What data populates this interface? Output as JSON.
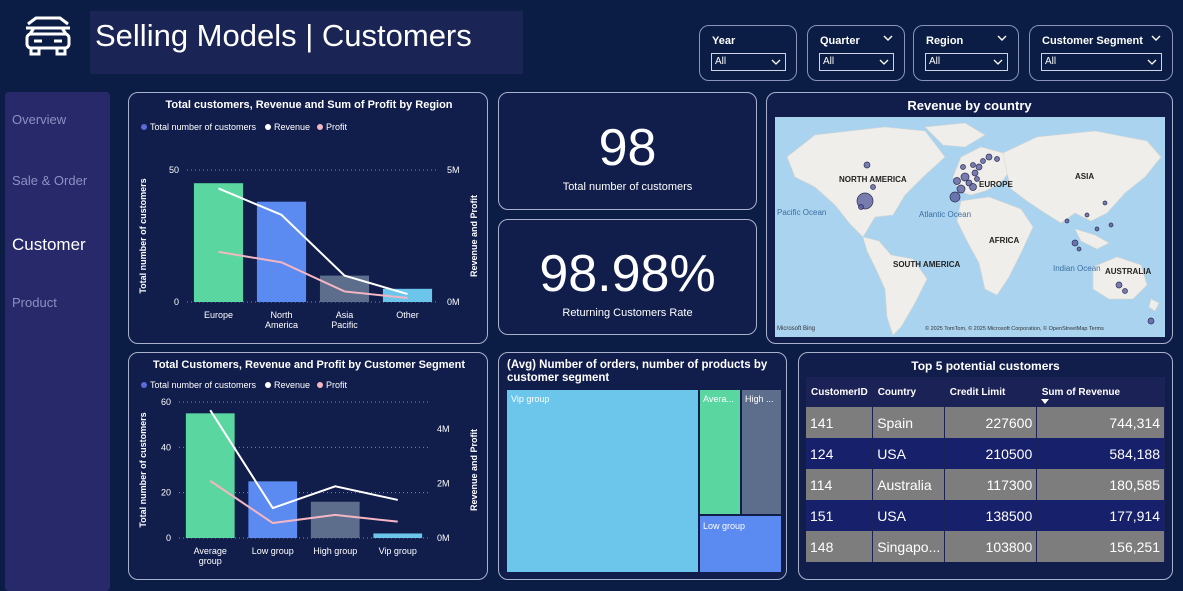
{
  "header": {
    "title": "Selling Models | Customers",
    "logo_icon": "car-icon"
  },
  "slicers": [
    {
      "label": "Year",
      "value": "All"
    },
    {
      "label": "Quarter",
      "value": "All"
    },
    {
      "label": "Region",
      "value": "All"
    },
    {
      "label": "Customer Segment",
      "value": "All"
    }
  ],
  "nav": {
    "items": [
      {
        "label": "Overview"
      },
      {
        "label": "Sale & Order"
      },
      {
        "label": "Customer"
      },
      {
        "label": "Product"
      }
    ],
    "active": "Customer"
  },
  "kpis": {
    "customers": {
      "value": "98",
      "label": "Total number of customers"
    },
    "returning": {
      "value": "98.98%",
      "label": "Returning Customers Rate"
    }
  },
  "map": {
    "title": "Revenue by country",
    "labels": {
      "north_america": "NORTH AMERICA",
      "europe": "EUROPE",
      "asia": "ASIA",
      "africa": "AFRICA",
      "south_america": "SOUTH AMERICA",
      "australia": "AUSTRALIA",
      "pacific": "Pacific Ocean",
      "atlantic": "Atlantic Ocean",
      "indian": "Indian Ocean"
    },
    "bing": "Microsoft Bing",
    "credit": "© 2025 TomTom, © 2025 Microsoft Corporation, © OpenStreetMap  Terms"
  },
  "treemap": {
    "title": "(Avg) Number of orders, number of products by customer segment",
    "tiles": [
      {
        "label": "Vip group",
        "color": "#6cc6ec"
      },
      {
        "label": "Avera...",
        "color": "#5ad6a0"
      },
      {
        "label": "High ...",
        "color": "#5c6e8c"
      },
      {
        "label": "Low group",
        "color": "#5b8af0"
      }
    ]
  },
  "top5": {
    "title": "Top 5 potential customers",
    "columns": [
      "CustomerID",
      "Country",
      "Credit Limit",
      "Sum of Revenue"
    ],
    "rows": [
      {
        "id": "141",
        "country": "Spain",
        "credit": "227600",
        "revenue": "744,314"
      },
      {
        "id": "124",
        "country": "USA",
        "credit": "210500",
        "revenue": "584,188"
      },
      {
        "id": "114",
        "country": "Australia",
        "credit": "117300",
        "revenue": "180,585"
      },
      {
        "id": "151",
        "country": "USA",
        "credit": "138500",
        "revenue": "177,914"
      },
      {
        "id": "148",
        "country": "Singapo...",
        "credit": "103800",
        "revenue": "156,251"
      }
    ]
  },
  "colors": {
    "customers": "#5ad6a0",
    "revenue": "#ffffff",
    "profit": "#f4b6c2",
    "bar_colors": [
      "#5ad6a0",
      "#5b8af0",
      "#5c6e8c",
      "#6cc6ec"
    ]
  },
  "chart_data": [
    {
      "type": "bar",
      "title": "Total customers, Revenue and Sum of Profit by Region",
      "categories": [
        "Europe",
        "North America",
        "Asia Pacific",
        "Other"
      ],
      "series": [
        {
          "name": "Total number of customers",
          "values": [
            45,
            38,
            10,
            5
          ]
        },
        {
          "name": "Revenue",
          "values": [
            4.3,
            3.3,
            1.0,
            0.3
          ]
        },
        {
          "name": "Profit",
          "values": [
            1.9,
            1.5,
            0.4,
            0.15
          ]
        }
      ],
      "ylabel": "Total number of customers",
      "y2label": "Revenue and Profit",
      "ylim": [
        0,
        50
      ],
      "y2lim": [
        0,
        5
      ],
      "yticks": [
        "0",
        "50"
      ],
      "y2ticks": [
        "0M",
        "5M"
      ],
      "legend": "top-left"
    },
    {
      "type": "bar",
      "title": "Total Customers, Revenue and Profit by Customer Segment",
      "categories": [
        "Average group",
        "Low group",
        "High group",
        "Vip group"
      ],
      "series": [
        {
          "name": "Total number of customers",
          "values": [
            55,
            25,
            16,
            2
          ]
        },
        {
          "name": "Revenue",
          "values": [
            4.7,
            1.1,
            1.9,
            1.4
          ]
        },
        {
          "name": "Profit",
          "values": [
            2.1,
            0.55,
            0.85,
            0.6
          ]
        }
      ],
      "ylabel": "Total number of customers",
      "y2label": "Revenue and Profit",
      "ylim": [
        0,
        60
      ],
      "y2lim": [
        0,
        5
      ],
      "yticks": [
        "0",
        "20",
        "40",
        "60"
      ],
      "y2ticks": [
        "0M",
        "2M",
        "4M"
      ],
      "legend": "top-left"
    }
  ]
}
